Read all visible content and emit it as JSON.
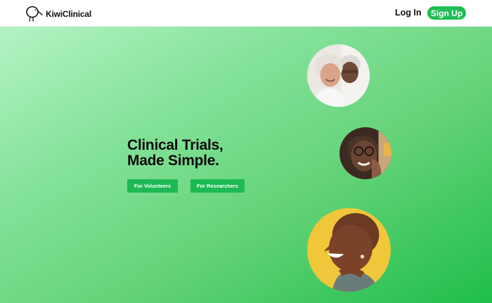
{
  "header": {
    "brand_name": "KiwiClinical",
    "login_label": "Log In",
    "signup_label": "Sign Up"
  },
  "hero": {
    "title_line1": "Clinical Trials,",
    "title_line2": "Made Simple.",
    "buttons": {
      "volunteers": "For Volunteers",
      "researchers": "For Researchers"
    }
  },
  "photos": [
    {
      "name": "elderly-couple-photo"
    },
    {
      "name": "elderly-woman-glasses-photo"
    },
    {
      "name": "smiling-woman-photo"
    }
  ],
  "colors": {
    "accent": "#1fbe55",
    "hero_gradient_start": "#b4f3c4",
    "hero_gradient_end": "#1fbe4a",
    "text_dark": "#111111"
  }
}
